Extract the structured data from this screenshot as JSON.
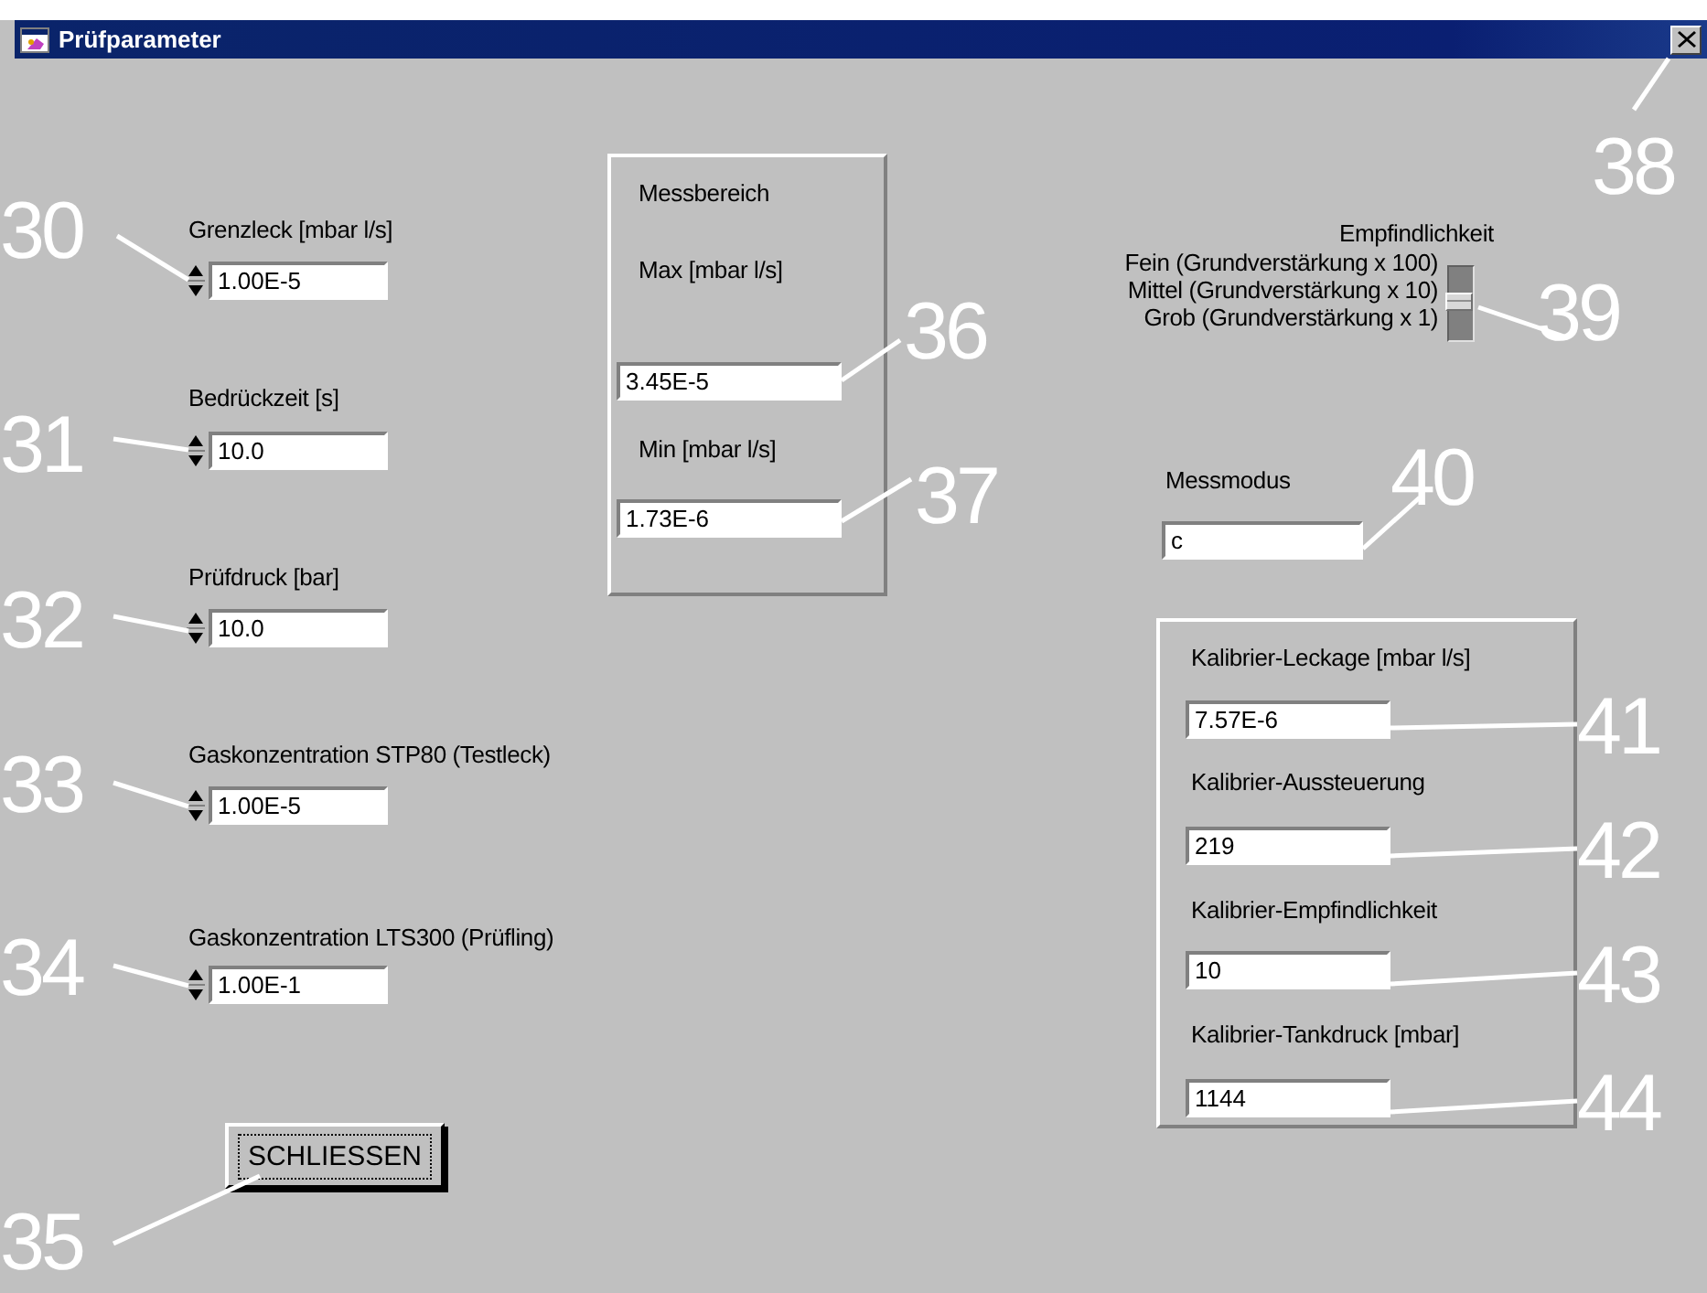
{
  "window": {
    "title": "Prüfparameter"
  },
  "left_controls": [
    {
      "label": "Grenzleck [mbar l/s]",
      "value": "1.00E-5"
    },
    {
      "label": "Bedrückzeit [s]",
      "value": "10.0"
    },
    {
      "label": "Prüfdruck [bar]",
      "value": "10.0"
    },
    {
      "label": "Gaskonzentration STP80 (Testleck)",
      "value": "1.00E-5"
    },
    {
      "label": "Gaskonzentration LTS300 (Prüfling)",
      "value": "1.00E-1"
    }
  ],
  "close_button": {
    "label": "SCHLIESSEN"
  },
  "messbereich": {
    "title": "Messbereich",
    "fields": [
      {
        "label": "Max [mbar l/s]",
        "value": "3.45E-5"
      },
      {
        "label": "Min [mbar l/s]",
        "value": "1.73E-6"
      }
    ]
  },
  "empfindlichkeit": {
    "label": "Empfindlichkeit",
    "options": [
      {
        "label": "Fein (Grundverstärkung x 100)",
        "selected": false
      },
      {
        "label": "Mittel (Grundverstärkung x 10)",
        "selected": true
      },
      {
        "label": "Grob (Grundverstärkung x 1)",
        "selected": false
      }
    ]
  },
  "messmodus": {
    "label": "Messmodus",
    "value": "c"
  },
  "kalibrier": {
    "fields": [
      {
        "label": "Kalibrier-Leckage [mbar l/s]",
        "value": "7.57E-6"
      },
      {
        "label": "Kalibrier-Aussteuerung",
        "value": "219"
      },
      {
        "label": "Kalibrier-Empfindlichkeit",
        "value": "10"
      },
      {
        "label": "Kalibrier-Tankdruck [mbar]",
        "value": "1144"
      }
    ]
  },
  "callouts": [
    "30",
    "31",
    "32",
    "33",
    "34",
    "35",
    "36",
    "37",
    "38",
    "39",
    "40",
    "41",
    "42",
    "43",
    "44"
  ]
}
